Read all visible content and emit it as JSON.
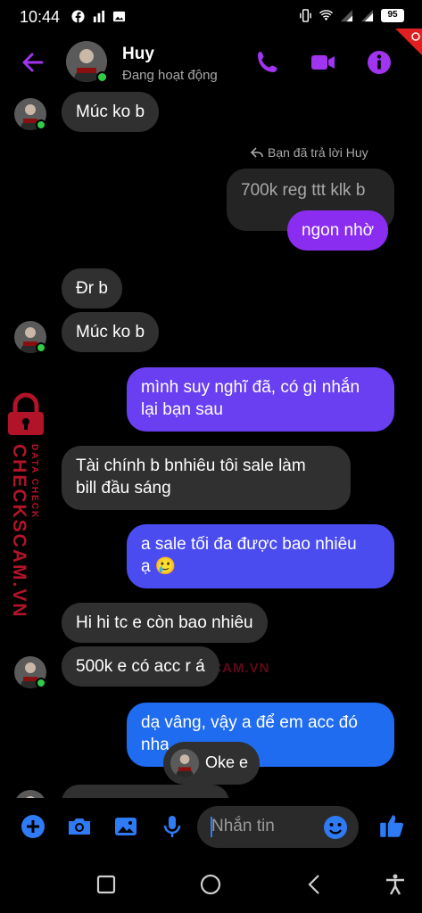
{
  "status_bar": {
    "time": "10:44",
    "battery": "95"
  },
  "header": {
    "name": "Huy",
    "status": "Đang hoạt động"
  },
  "reply_note": "Bạn đã trả lời Huy",
  "messages": [
    {
      "text": "Múc ko b"
    },
    {
      "text": "700k reg ttt klk b"
    },
    {
      "text": "ngon nhờ"
    },
    {
      "text": "Đr b"
    },
    {
      "text": "Múc ko b"
    },
    {
      "line1": "mình suy nghĩ đã, có gì nhắn",
      "line2": "lại bạn sau"
    },
    {
      "line1": "Tài chính b bnhiêu tôi sale làm",
      "line2": "bill đầu sáng"
    },
    {
      "line1": "a sale tối đa được bao nhiêu",
      "line2": "ạ 🥲"
    },
    {
      "text": "Hi hi tc e còn bao nhiêu"
    },
    {
      "text": "500k e có acc r á"
    },
    {
      "line1": "dạ vâng, vậy a để em acc đó",
      "line2": "nha"
    }
  ],
  "typing_indicator": "Oke e",
  "composer": {
    "placeholder": "Nhắn tin"
  },
  "watermark": {
    "main": "CHECKSCAM.VN",
    "small": "DATA CHECK",
    "center": "CHECKSCAM.VN"
  },
  "colors": {
    "accent": "#a034f0",
    "sent_purple": "#8a2df0",
    "sent_violet": "#6a3ff2",
    "sent_indigo": "#4a4cf0",
    "sent_blue": "#2e5ef0",
    "sent_azure": "#1f6cf0",
    "received": "#303030",
    "composer_blue": "#2f7bf5",
    "watermark_red": "#d01830",
    "online_green": "#31cc46"
  }
}
